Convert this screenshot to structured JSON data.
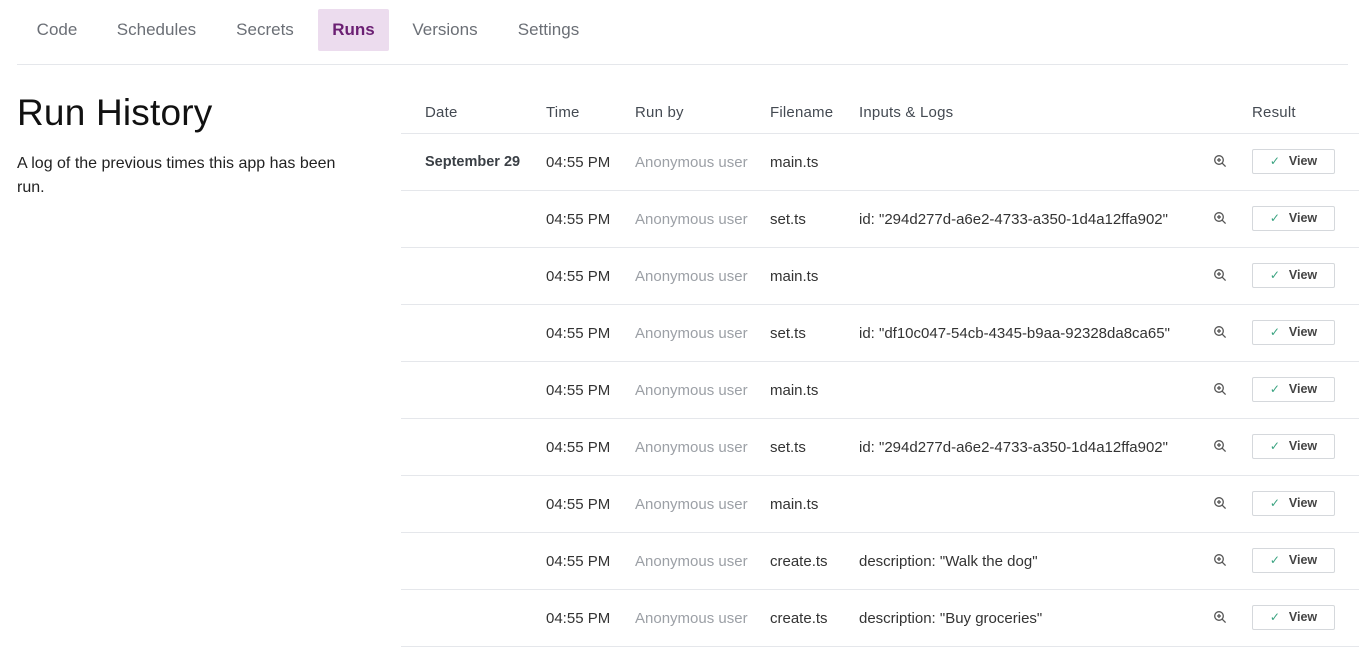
{
  "tabs": [
    {
      "label": "Code",
      "active": false
    },
    {
      "label": "Schedules",
      "active": false
    },
    {
      "label": "Secrets",
      "active": false
    },
    {
      "label": "Runs",
      "active": true
    },
    {
      "label": "Versions",
      "active": false
    },
    {
      "label": "Settings",
      "active": false
    }
  ],
  "sidebar": {
    "title": "Run History",
    "description": "A log of the previous times this app has been run."
  },
  "table": {
    "headers": {
      "date": "Date",
      "time": "Time",
      "run_by": "Run by",
      "filename": "Filename",
      "inputs_logs": "Inputs & Logs",
      "result": "Result"
    },
    "view_label": "View",
    "rows": [
      {
        "date": "September 29",
        "time": "04:55 PM",
        "run_by": "Anonymous user",
        "filename": "main.ts",
        "inputs": ""
      },
      {
        "date": "",
        "time": "04:55 PM",
        "run_by": "Anonymous user",
        "filename": "set.ts",
        "inputs": "id: \"294d277d-a6e2-4733-a350-1d4a12ffa902\""
      },
      {
        "date": "",
        "time": "04:55 PM",
        "run_by": "Anonymous user",
        "filename": "main.ts",
        "inputs": ""
      },
      {
        "date": "",
        "time": "04:55 PM",
        "run_by": "Anonymous user",
        "filename": "set.ts",
        "inputs": "id: \"df10c047-54cb-4345-b9aa-92328da8ca65\""
      },
      {
        "date": "",
        "time": "04:55 PM",
        "run_by": "Anonymous user",
        "filename": "main.ts",
        "inputs": ""
      },
      {
        "date": "",
        "time": "04:55 PM",
        "run_by": "Anonymous user",
        "filename": "set.ts",
        "inputs": "id: \"294d277d-a6e2-4733-a350-1d4a12ffa902\""
      },
      {
        "date": "",
        "time": "04:55 PM",
        "run_by": "Anonymous user",
        "filename": "main.ts",
        "inputs": ""
      },
      {
        "date": "",
        "time": "04:55 PM",
        "run_by": "Anonymous user",
        "filename": "create.ts",
        "inputs": "description: \"Walk the dog\""
      },
      {
        "date": "",
        "time": "04:55 PM",
        "run_by": "Anonymous user",
        "filename": "create.ts",
        "inputs": "description: \"Buy groceries\""
      }
    ]
  },
  "icons": {
    "zoom": "zoom-in-icon",
    "check": "check-icon"
  },
  "colors": {
    "active_tab_bg": "#ecdcee",
    "active_tab_text": "#6b1f73",
    "check": "#3aa380",
    "muted_text": "#9ca0a6"
  }
}
